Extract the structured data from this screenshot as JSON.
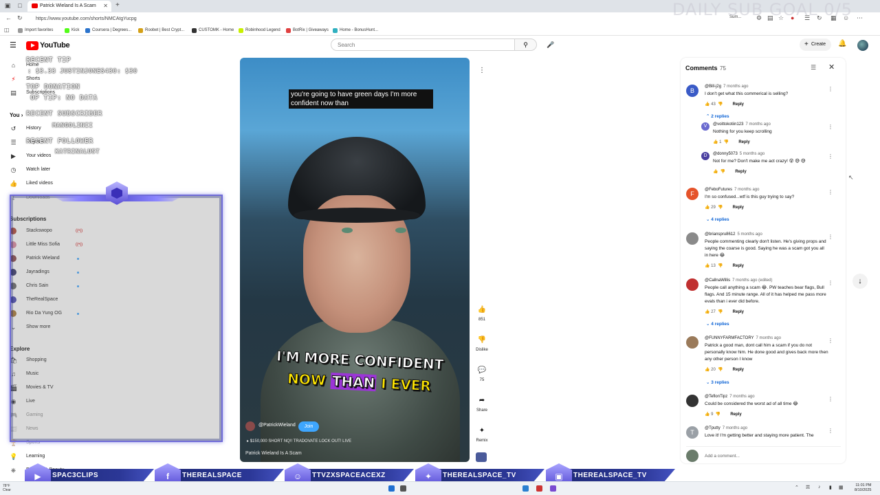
{
  "browser": {
    "tab_title": "Patrick Wieland Is A Scam",
    "url": "https://www.youtube.com/shorts/NMCAtgYucpg",
    "bookmarks": [
      {
        "label": "Import favorites",
        "color": "#888888"
      },
      {
        "label": "Kick",
        "color": "#53fc18"
      },
      {
        "label": "Coursera | Degrees...",
        "color": "#2a73cc"
      },
      {
        "label": "Roobet | Best Crypt...",
        "color": "#d4a017"
      },
      {
        "label": "CUSTOMK - Home",
        "color": "#333333"
      },
      {
        "label": "Robinhood Legend",
        "color": "#c8f000"
      },
      {
        "label": "BotRix | Giveaways",
        "color": "#e04040"
      },
      {
        "label": "Home - BonusHunt...",
        "color": "#30b0c0"
      }
    ],
    "right_text": "Sum..."
  },
  "overlay": {
    "goal": "DAILY SUB GOAL 0/5",
    "recent_tip_label": "RECENT TIP",
    "recent_tip_value": ": $3.33   JUSTINJONES430: $30",
    "top_donation_label": "TOP DONATION",
    "top_tip": "OP TIP: NO DATA",
    "recent_subscriber_label": "RECENT SUBSCRIBER",
    "recent_subscriber": "MANGOLINII",
    "recent_follower_label": "RECENT FOLLOWER",
    "recent_follower": "KATRINALUST"
  },
  "youtube": {
    "logo": "YouTube",
    "search_placeholder": "Search",
    "create_label": "Create"
  },
  "nav": {
    "home": "Home",
    "shorts": "Shorts",
    "subscriptions": "Subscriptions",
    "you": "You",
    "history": "History",
    "playlists": "Playlists",
    "your_videos": "Your videos",
    "watch_later": "Watch later",
    "liked_videos": "Liked videos",
    "downloads": "Downloads",
    "subs_header": "Subscriptions",
    "channels": [
      {
        "name": "Stackswopo",
        "color": "#b04a3a",
        "mark": "live"
      },
      {
        "name": "Little Miss Sofia",
        "color": "#d88aa0",
        "mark": "live"
      },
      {
        "name": "Patrick Wieland",
        "color": "#8a4a4a",
        "mark": "dot"
      },
      {
        "name": "Jayradings",
        "color": "#3a3a6a",
        "mark": "dot"
      },
      {
        "name": "Chris Sain",
        "color": "#6a6a6a",
        "mark": "dot"
      },
      {
        "name": "TheRealSpace",
        "color": "#4a4ab0",
        "mark": ""
      },
      {
        "name": "Rio Da Yung OG",
        "color": "#aa7a3a",
        "mark": "dot"
      }
    ],
    "show_more": "Show more",
    "explore": "Explore",
    "shopping": "Shopping",
    "music": "Music",
    "movies": "Movies & TV",
    "live": "Live",
    "gaming": "Gaming",
    "news": "News",
    "sports": "Sports",
    "learning": "Learning",
    "fashion": "Fashion & Beauty",
    "live_icon_text": "((•))"
  },
  "video": {
    "caption": "you're going to have green days I'm more confident now than",
    "big_line1": "I'M MORE CONFIDENT",
    "big_line2_a": "NOW ",
    "big_line2_b": "THAN",
    "big_line2_c": " I EVER",
    "channel": "@PatrickWieland",
    "join": "Join",
    "promo": "$150,000 SHORT NQ!! TRADOVATE LOCK OUT! LIVE",
    "title": "Patrick Wieland Is A Scam",
    "likes": "851",
    "dislike": "Dislike",
    "comments": "75",
    "share": "Share",
    "remix": "Remix"
  },
  "comments_panel": {
    "title": "Comments",
    "count": "75",
    "add_placeholder": "Add a comment...",
    "reply_label": "Reply",
    "items": [
      {
        "handle": "@Bill-j2g",
        "time": "7 months ago",
        "text": "I don't get what this commerical is selling?",
        "likes": "43",
        "avatar": "B",
        "color": "#3a5bc7"
      },
      {
        "handle": "@voittokotiin123",
        "time": "7 months ago",
        "text": "Nothing for you keep scrolling",
        "likes": "1",
        "avatar": "V",
        "color": "#6a6acf"
      },
      {
        "handle": "@donny5073",
        "time": "5 months ago",
        "text": "Not for me? Don't make me act crazy! 😵 😅 😅",
        "likes": "",
        "avatar": "D",
        "color": "#4a3fa0"
      },
      {
        "handle": "@FeboFutures",
        "time": "7 months ago",
        "text": "I'm so confused...wtf is this guy trying to say?",
        "likes": "29",
        "avatar": "F",
        "color": "#e5532a"
      },
      {
        "handle": "@brianspru8612",
        "time": "5 months ago",
        "text": "People commenting clearly don't listen. He's giving props and saying the coarse is good. Saying he was a scam got you all in here 😂",
        "likes": "13",
        "avatar": "",
        "color": "#8a8a8a"
      },
      {
        "handle": "@CallnaWillis",
        "time": "7 months ago (edited)",
        "text": "People call anything a scam 😂. PW teaches bear flags, Bull flags. And 15 minute range. All of it has helped me pass more evals than i ever did before.",
        "likes": "27",
        "avatar": "",
        "color": "#c03030"
      },
      {
        "handle": "@FUNNYFARMFACTORY",
        "time": "7 months ago",
        "text": "Patrick a good man, dont call him a scam if you do not personally know him. He done good and gives back more then any other person I know",
        "likes": "20",
        "avatar": "",
        "color": "#9a7a5a"
      },
      {
        "handle": "@TeflonTipz",
        "time": "7 months ago",
        "text": "Could be considered the worst ad of all time 😂",
        "likes": "9",
        "avatar": "",
        "color": "#333333"
      },
      {
        "handle": "@Tputty",
        "time": "7 months ago",
        "text": "Love it! I'm getting better and staying more patient. The",
        "likes": "",
        "avatar": "T",
        "color": "#9aa0a6"
      }
    ],
    "replies_1": "2 replies",
    "replies_4": "4 replies",
    "replies_6": "4 replies",
    "replies_7": "3 replies"
  },
  "socials": [
    {
      "label": "SPAC3CLIPS",
      "icon": "▶"
    },
    {
      "label": "THEREALSPACE",
      "icon": "f"
    },
    {
      "label": "TTVZXSPACEACEXZ",
      "icon": "☺"
    },
    {
      "label": "THEREALSPACE_TV",
      "icon": "✦"
    },
    {
      "label": "THEREALSPACE_TV",
      "icon": "▣"
    }
  ],
  "taskbar": {
    "time": "11:01 PM",
    "date": "8/10/2025",
    "weather": "78°F",
    "weather_sub": "Clear"
  }
}
